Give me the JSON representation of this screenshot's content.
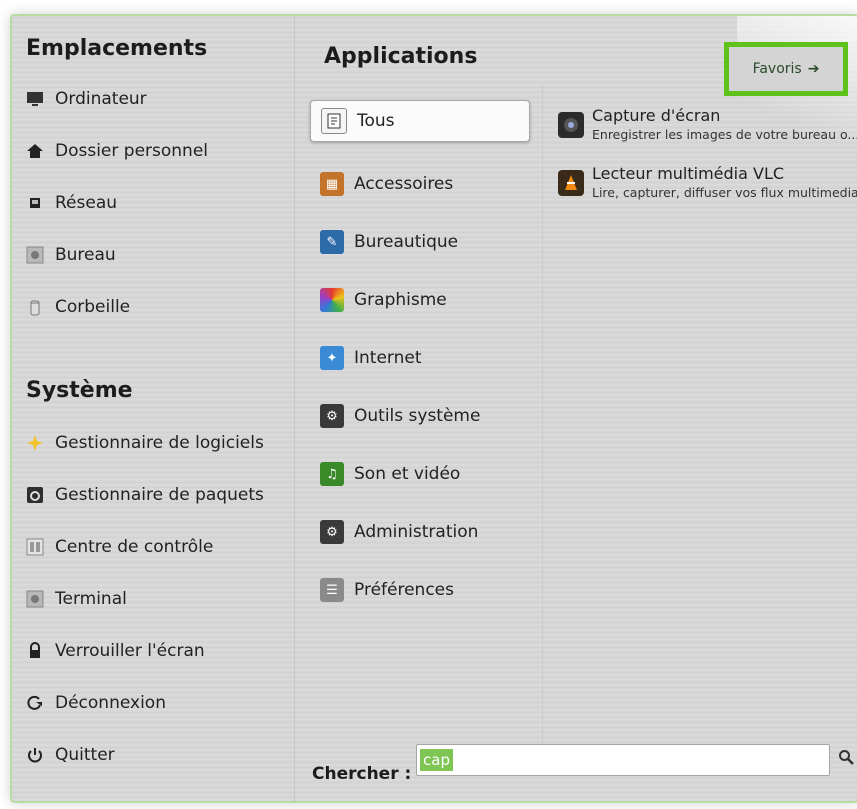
{
  "places": {
    "title": "Emplacements",
    "items": [
      {
        "label": "Ordinateur",
        "icon": "monitor-icon"
      },
      {
        "label": "Dossier personnel",
        "icon": "home-icon"
      },
      {
        "label": "Réseau",
        "icon": "network-icon"
      },
      {
        "label": "Bureau",
        "icon": "desktop-folder-icon"
      },
      {
        "label": "Corbeille",
        "icon": "trash-icon"
      }
    ]
  },
  "system": {
    "title": "Système",
    "items": [
      {
        "label": "Gestionnaire de logiciels",
        "icon": "software-manager-icon"
      },
      {
        "label": "Gestionnaire de paquets",
        "icon": "package-manager-icon"
      },
      {
        "label": "Centre de contrôle",
        "icon": "control-center-icon"
      },
      {
        "label": "Terminal",
        "icon": "terminal-icon"
      },
      {
        "label": "Verrouiller l'écran",
        "icon": "lock-icon"
      },
      {
        "label": "Déconnexion",
        "icon": "logout-icon"
      },
      {
        "label": "Quitter",
        "icon": "power-icon"
      }
    ]
  },
  "applications": {
    "title": "Applications",
    "selected": "Tous",
    "categories": [
      {
        "label": "Tous",
        "icon": "all-apps-icon",
        "color": "#f5f5f5"
      },
      {
        "label": "Accessoires",
        "icon": "accessories-icon",
        "color": "#c4732a"
      },
      {
        "label": "Bureautique",
        "icon": "office-icon",
        "color": "#2d6aa8"
      },
      {
        "label": "Graphisme",
        "icon": "graphics-icon",
        "color": "#e0403a"
      },
      {
        "label": "Internet",
        "icon": "internet-icon",
        "color": "#3a8ad6"
      },
      {
        "label": "Outils système",
        "icon": "system-tools-icon",
        "color": "#3a3a3a"
      },
      {
        "label": "Son et vidéo",
        "icon": "sound-video-icon",
        "color": "#3b8a2a"
      },
      {
        "label": "Administration",
        "icon": "administration-icon",
        "color": "#3a3a3a"
      },
      {
        "label": "Préférences",
        "icon": "preferences-icon",
        "color": "#8a8a8a"
      }
    ]
  },
  "results": [
    {
      "name": "Capture d'écran",
      "desc": "Enregistrer les images de votre bureau o...",
      "icon": "screenshot-icon",
      "color": "#2b2b2b"
    },
    {
      "name": "Lecteur multimédia VLC",
      "desc": "Lire, capturer, diffuser vos flux multimedia",
      "icon": "vlc-icon",
      "color": "#e07a12"
    }
  ],
  "favorites": {
    "label": "Favoris"
  },
  "search": {
    "label": "Chercher :",
    "value": "cap"
  }
}
